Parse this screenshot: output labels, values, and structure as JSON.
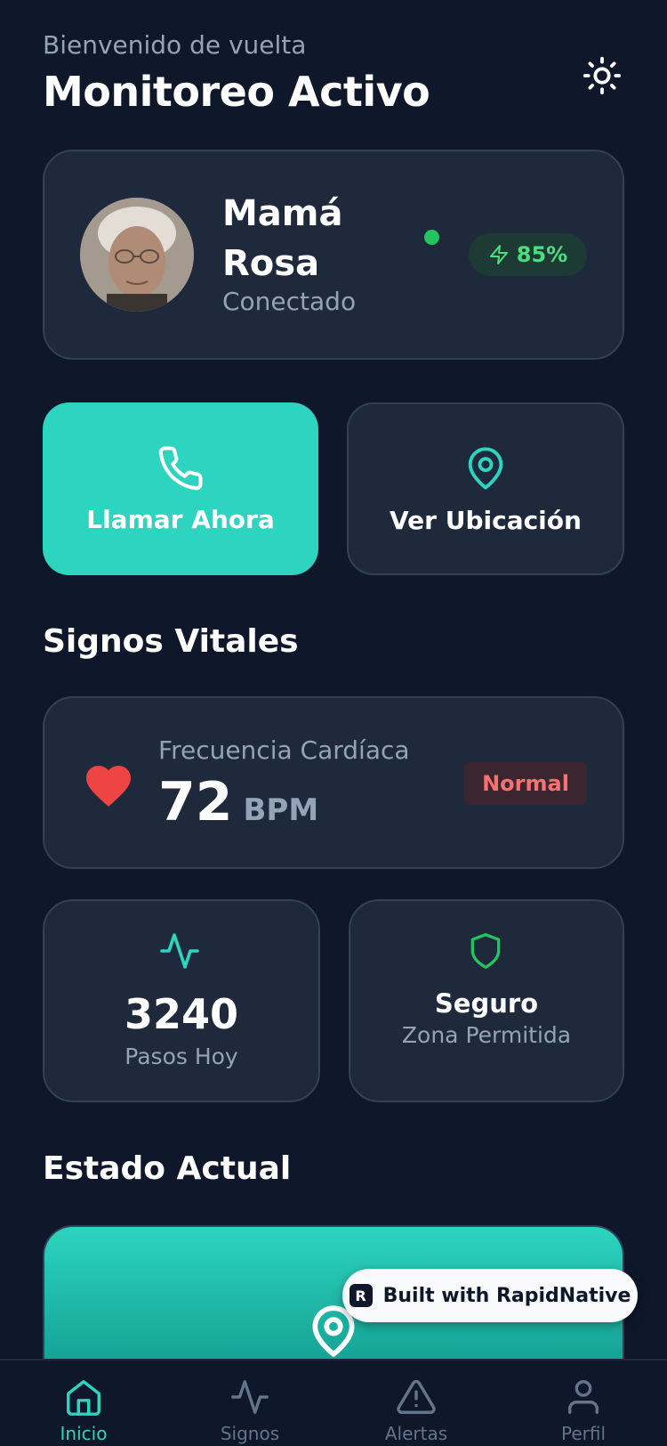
{
  "header": {
    "greeting": "Bienvenido de vuelta",
    "title": "Monitoreo Activo",
    "theme_icon": "sun-icon"
  },
  "profile": {
    "name": "Mamá Rosa",
    "status": "Conectado",
    "battery": "85%",
    "online_color": "#22c55e"
  },
  "actions": {
    "call_label": "Llamar Ahora",
    "location_label": "Ver Ubicación",
    "call_icon": "phone-icon",
    "location_icon": "map-pin-icon"
  },
  "vitals": {
    "section_title": "Signos Vitales",
    "heart_rate": {
      "label": "Frecuencia Cardíaca",
      "value": "72",
      "unit": "BPM",
      "badge": "Normal"
    },
    "steps": {
      "value": "3240",
      "label": "Pasos Hoy"
    },
    "safety": {
      "value": "Seguro",
      "label": "Zona Permitida"
    }
  },
  "state": {
    "section_title": "Estado Actual"
  },
  "badge": {
    "text": "Built with RapidNative",
    "logo": "R"
  },
  "nav": {
    "items": [
      {
        "label": "Inicio",
        "icon": "home-icon",
        "active": true
      },
      {
        "label": "Signos",
        "icon": "activity-icon",
        "active": false
      },
      {
        "label": "Alertas",
        "icon": "alert-triangle-icon",
        "active": false
      },
      {
        "label": "Perfil",
        "icon": "user-icon",
        "active": false
      }
    ]
  },
  "colors": {
    "background": "#0f172a",
    "card": "#1e293b",
    "accent": "#2dd4bf",
    "danger": "#ef4444",
    "success": "#22c55e"
  }
}
